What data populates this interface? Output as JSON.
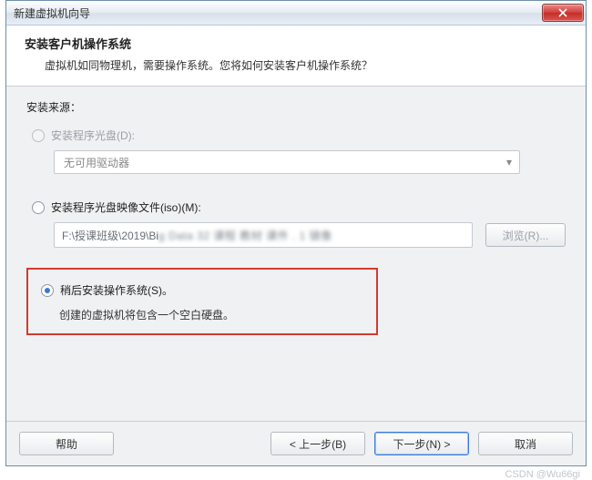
{
  "titlebar": {
    "title": "新建虚拟机向导"
  },
  "header": {
    "heading": "安装客户机操作系统",
    "sub": "虚拟机如同物理机，需要操作系统。您将如何安装客户机操作系统？"
  },
  "source_label": "安装来源：",
  "opt_disc": {
    "label": "安装程序光盘(D):",
    "select_text": "无可用驱动器"
  },
  "opt_iso": {
    "label": "安装程序光盘映像文件(iso)(M):",
    "path_prefix": "F:\\授课班级\\2019\\Bi",
    "path_blur": "g Data 32 课程 教材 课件 . 1 镜像",
    "browse": "浏览(R)..."
  },
  "opt_later": {
    "label": "稍后安装操作系统(S)。",
    "desc": "创建的虚拟机将包含一个空白硬盘。"
  },
  "footer": {
    "help": "帮助",
    "back": "< 上一步(B)",
    "next": "下一步(N) >",
    "cancel": "取消"
  },
  "watermark": "CSDN @Wu66gi"
}
